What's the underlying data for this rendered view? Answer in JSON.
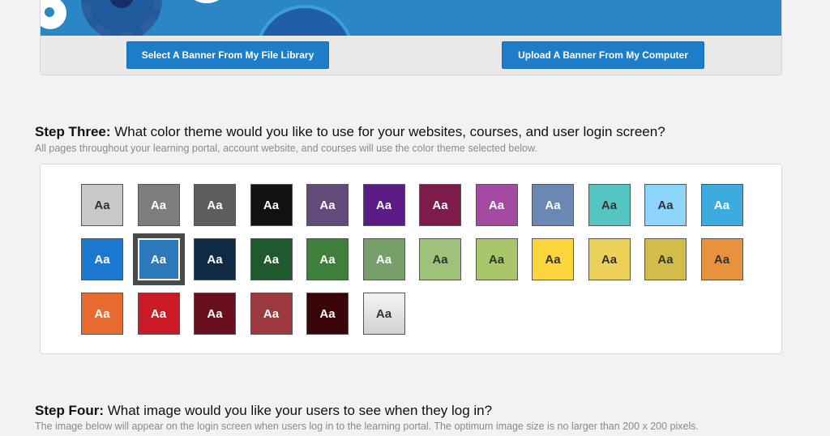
{
  "banner": {
    "library_button": "Select A Banner From My File Library",
    "upload_button": "Upload A Banner From My Computer"
  },
  "step3": {
    "label": "Step Three:",
    "question": " What color theme would you like to use for your websites, courses, and user login screen?",
    "description": "All pages throughout your learning portal, account website, and courses will use the color theme selected below."
  },
  "themes": {
    "swatch_text": "Aa",
    "selected_index": 13,
    "colors": [
      {
        "bg": "#c8c8c8",
        "fg": "#333333"
      },
      {
        "bg": "#7d7d7d",
        "fg": "#ffffff"
      },
      {
        "bg": "#5e5e5e",
        "fg": "#ffffff"
      },
      {
        "bg": "#111111",
        "fg": "#ffffff"
      },
      {
        "bg": "#654a7c",
        "fg": "#ffffff"
      },
      {
        "bg": "#5b1d85",
        "fg": "#ffffff"
      },
      {
        "bg": "#7d1b4a",
        "fg": "#ffffff"
      },
      {
        "bg": "#a34ba0",
        "fg": "#ffffff"
      },
      {
        "bg": "#6a88b3",
        "fg": "#ffffff"
      },
      {
        "bg": "#54c5c3",
        "fg": "#333333"
      },
      {
        "bg": "#8dd5fb",
        "fg": "#333333"
      },
      {
        "bg": "#3cace0",
        "fg": "#ffffff"
      },
      {
        "bg": "#1c79d1",
        "fg": "#ffffff"
      },
      {
        "bg": "#2b79ba",
        "fg": "#ffffff"
      },
      {
        "bg": "#0f2a45",
        "fg": "#ffffff"
      },
      {
        "bg": "#1e5a2e",
        "fg": "#ffffff"
      },
      {
        "bg": "#3f7f3c",
        "fg": "#ffffff"
      },
      {
        "bg": "#779f6a",
        "fg": "#ffffff"
      },
      {
        "bg": "#9ec27a",
        "fg": "#333333"
      },
      {
        "bg": "#a9c66a",
        "fg": "#333333"
      },
      {
        "bg": "#fcd43c",
        "fg": "#333333"
      },
      {
        "bg": "#ecd25a",
        "fg": "#333333"
      },
      {
        "bg": "#d4bc4a",
        "fg": "#333333"
      },
      {
        "bg": "#e9923e",
        "fg": "#333333"
      },
      {
        "bg": "#e76a2e",
        "fg": "#ffffff"
      },
      {
        "bg": "#c91a25",
        "fg": "#ffffff"
      },
      {
        "bg": "#6a0f1f",
        "fg": "#ffffff"
      },
      {
        "bg": "#9c3a40",
        "fg": "#ffffff"
      },
      {
        "bg": "#3a0508",
        "fg": "#ffffff"
      },
      {
        "bg": "#e1e1e1",
        "fg": "#333333"
      }
    ]
  },
  "step4": {
    "label": "Step Four:",
    "question": " What image would you like your users to see when they log in?",
    "description": "The image below will appear on the login screen when users log in to the learning portal. The optimum image size is no larger than 200 x 200 pixels."
  }
}
